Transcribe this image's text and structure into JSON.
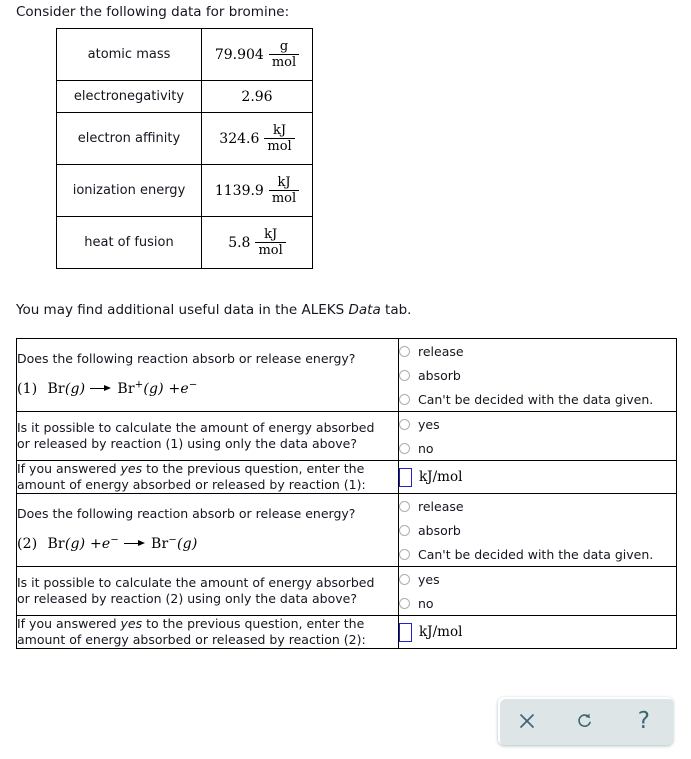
{
  "intro": {
    "text": "Consider the following data for bromine:"
  },
  "data_table": {
    "rows": [
      {
        "property": "atomic mass",
        "value": "79.904",
        "unit_numerator": "g",
        "unit_denominator": "mol",
        "has_fraction": true
      },
      {
        "property": "electronegativity",
        "value": "2.96",
        "unit_numerator": "",
        "unit_denominator": "",
        "has_fraction": false
      },
      {
        "property": "electron affinity",
        "value": "324.6",
        "unit_numerator": "kJ",
        "unit_denominator": "mol",
        "has_fraction": true
      },
      {
        "property": "ionization energy",
        "value": "1139.9",
        "unit_numerator": "kJ",
        "unit_denominator": "mol",
        "has_fraction": true
      },
      {
        "property": "heat of fusion",
        "value": "5.8",
        "unit_numerator": "kJ",
        "unit_denominator": "mol",
        "has_fraction": true
      }
    ]
  },
  "aleks_note": {
    "before": "You may find additional useful data in the ALEKS ",
    "emphasis": "Data",
    "after": " tab."
  },
  "questions": {
    "r1_absorb_release": {
      "question": "Does the following reaction absorb or release energy?",
      "equation": {
        "number": "(1)",
        "reactant_species": "Br",
        "reactant_state": "(g)",
        "product_species": "Br",
        "product_charge": "+",
        "product_state": "(g)",
        "plus": "+",
        "electron": "e",
        "electron_charge": "−"
      }
    },
    "r1_possible": {
      "question_line1": "Is it possible to calculate the amount of energy absorbed",
      "question_line2": "or released by reaction (1) using only the data above?"
    },
    "r1_amount": {
      "line1_before": "If you answered ",
      "line1_emphasis": "yes",
      "line1_after": " to the previous question, enter the",
      "line2": "amount of energy absorbed or released by reaction (1):"
    },
    "r2_absorb_release": {
      "question": "Does the following reaction absorb or release energy?",
      "equation": {
        "number": "(2)",
        "reactant_species": "Br",
        "reactant_state": "(g)",
        "plus": "+",
        "electron": "e",
        "electron_charge": "−",
        "product_species": "Br",
        "product_charge": "−",
        "product_state": "(g)"
      }
    },
    "r2_possible": {
      "question_line1": "Is it possible to calculate the amount of energy absorbed",
      "question_line2": "or released by reaction (2) using only the data above?"
    },
    "r2_amount": {
      "line1_before": "If you answered ",
      "line1_emphasis": "yes",
      "line1_after": " to the previous question, enter the",
      "line2": "amount of energy absorbed or released by reaction (2):"
    }
  },
  "answers": {
    "energy_direction_options": [
      "release",
      "absorb",
      "Can't be decided with the data given."
    ],
    "yes_no_options": [
      "yes",
      "no"
    ],
    "input_unit": "kJ/mol",
    "input_value": "",
    "input_placeholder": ""
  },
  "toolbar": {
    "clear_label": "✕",
    "reset_label": "↺",
    "help_label": "?",
    "icon_color": "#3d6471",
    "background_color": "#dde5e7"
  }
}
